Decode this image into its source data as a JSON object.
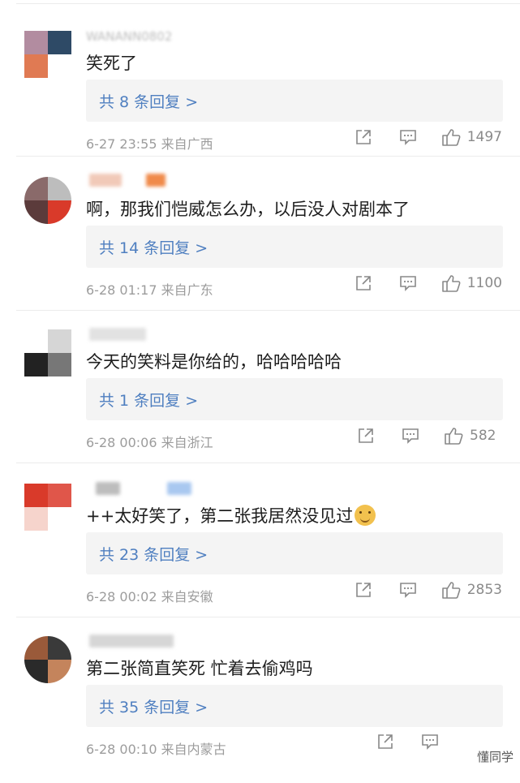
{
  "comments": [
    {
      "username": "WANANN0802",
      "text": "笑死了",
      "has_emoji": false,
      "replies": "共 8 条回复 >",
      "meta": "6-27 23:55  来自广西",
      "likes": "1497",
      "avatar_colors": [
        "#b28ca0",
        "#2e4a66",
        "#e07a53",
        "#ffffff"
      ]
    },
    {
      "username": "",
      "text": "啊，那我们恺威怎么办，以后没人对剧本了",
      "has_emoji": false,
      "replies": "共 14 条回复 >",
      "meta": "6-28 01:17  来自广东",
      "likes": "1100",
      "avatar_colors": [
        "#8a6a6a",
        "#bdbdbd",
        "#5b3b3b",
        "#d93a2a"
      ]
    },
    {
      "username": "",
      "text": "今天的笑料是你给的，哈哈哈哈哈",
      "has_emoji": false,
      "replies": "共 1 条回复 >",
      "meta": "6-28 00:06  来自浙江",
      "likes": "582",
      "avatar_colors": [
        "#ffffff",
        "#d6d6d6",
        "#222222",
        "#777777"
      ]
    },
    {
      "username": "",
      "text": "++太好笑了，第二张我居然没见过",
      "has_emoji": true,
      "replies": "共 23 条回复 >",
      "meta": "6-28 00:02  来自安徽",
      "likes": "2853",
      "avatar_colors": [
        "#d93a2a",
        "#e0564a",
        "#f6d4cc",
        "#ffffff"
      ]
    },
    {
      "username": "",
      "text": "第二张简直笑死 忙着去偷鸡吗",
      "has_emoji": false,
      "replies": "共 35 条回复 >",
      "meta": "6-28 00:10  来自内蒙古",
      "likes": "",
      "avatar_colors": [
        "#9a5a3a",
        "#3a3a3a",
        "#2a2a2a",
        "#c4845c"
      ]
    }
  ],
  "watermark": "懂同学"
}
